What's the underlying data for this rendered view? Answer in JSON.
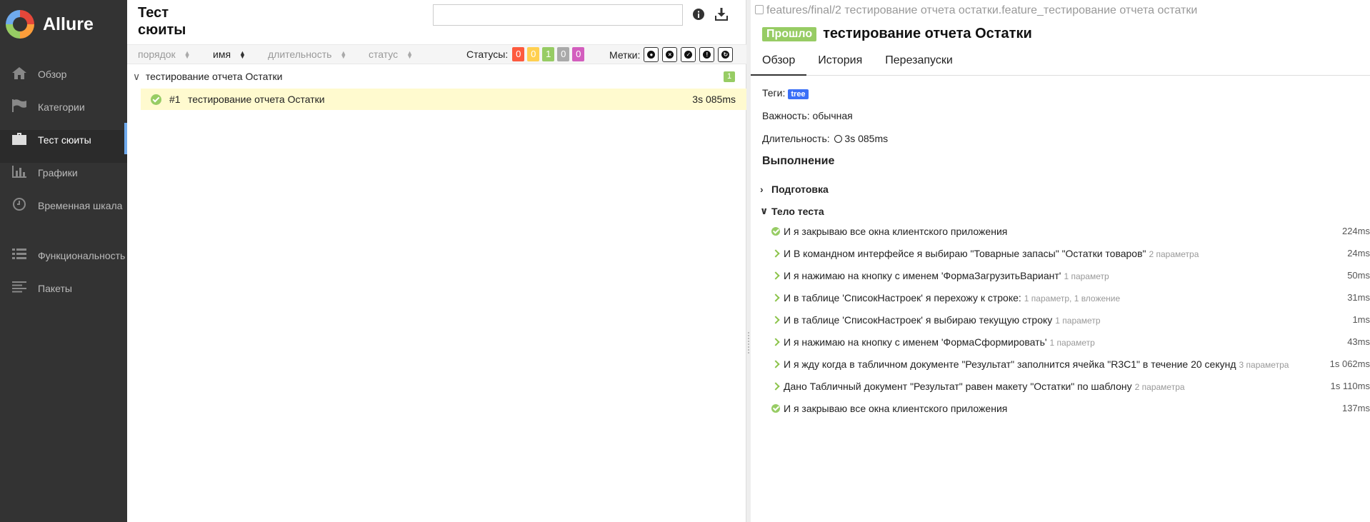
{
  "app": {
    "name": "Allure"
  },
  "sidebar": {
    "items": [
      {
        "label": "Обзор",
        "icon": "home-icon"
      },
      {
        "label": "Категории",
        "icon": "flag-icon"
      },
      {
        "label": "Тест сюиты",
        "icon": "briefcase-icon"
      },
      {
        "label": "Графики",
        "icon": "bar-chart-icon"
      },
      {
        "label": "Временная шкала",
        "icon": "clock-icon"
      },
      {
        "label": "Функциональность",
        "icon": "list-icon"
      },
      {
        "label": "Пакеты",
        "icon": "align-left-icon"
      }
    ]
  },
  "middle": {
    "title": "Тест сюиты",
    "search": {
      "value": "",
      "placeholder": ""
    },
    "sort": {
      "order": "порядок",
      "name": "имя",
      "duration": "длительность",
      "status": "статус"
    },
    "statuses_label": "Статусы:",
    "status_counts": [
      {
        "value": "0",
        "color": "#fd5a3e"
      },
      {
        "value": "0",
        "color": "#ffd050"
      },
      {
        "value": "1",
        "color": "#97cc64"
      },
      {
        "value": "0",
        "color": "#aaaaaa"
      },
      {
        "value": "0",
        "color": "#d35ebe"
      }
    ],
    "marks_label": "Метки:",
    "group": {
      "name": "тестирование отчета Остатки",
      "count": "1"
    },
    "test": {
      "number": "#1",
      "name": "тестирование отчета Остатки",
      "duration": "3s 085ms"
    }
  },
  "right": {
    "path": "features/final/2 тестирование отчета остатки.feature_тестирование отчета остатки",
    "status": "Прошло",
    "title": "тестирование отчета Остатки",
    "tabs": [
      "Обзор",
      "История",
      "Перезапуски"
    ],
    "tags_label": "Теги:",
    "tag": "tree",
    "severity": "Важность: обычная",
    "duration_label": "Длительность:",
    "duration": "3s 085ms",
    "execution_title": "Выполнение",
    "setup": "Подготовка",
    "body": "Тело теста",
    "steps": [
      {
        "status": "passed",
        "text": "И я закрываю все окна клиентского приложения",
        "params": "",
        "duration": "224ms"
      },
      {
        "status": "expand",
        "text": "И В командном интерфейсе я выбираю \"Товарные запасы\" \"Остатки товаров\"",
        "params": "2 параметра",
        "duration": "24ms"
      },
      {
        "status": "expand",
        "text": "И я нажимаю на кнопку с именем 'ФормаЗагрузитьВариант'",
        "params": "1 параметр",
        "duration": "50ms"
      },
      {
        "status": "expand",
        "text": "И в таблице 'СписокНастроек' я перехожу к строке:",
        "params": "1 параметр, 1 вложение",
        "duration": "31ms"
      },
      {
        "status": "expand",
        "text": "И в таблице 'СписокНастроек' я выбираю текущую строку",
        "params": "1 параметр",
        "duration": "1ms"
      },
      {
        "status": "expand",
        "text": "И я нажимаю на кнопку с именем 'ФормаСформировать'",
        "params": "1 параметр",
        "duration": "43ms"
      },
      {
        "status": "expand",
        "text": "И я жду когда в табличном документе \"Результат\" заполнится ячейка \"R3C1\" в течение 20 секунд",
        "params": "3 параметра",
        "duration": "1s 062ms"
      },
      {
        "status": "expand",
        "text": "Дано Табличный документ \"Результат\" равен макету \"Остатки\" по шаблону",
        "params": "2 параметра",
        "duration": "1s 110ms"
      },
      {
        "status": "passed",
        "text": "И я закрываю все окна клиентского приложения",
        "params": "",
        "duration": "137ms"
      }
    ]
  }
}
